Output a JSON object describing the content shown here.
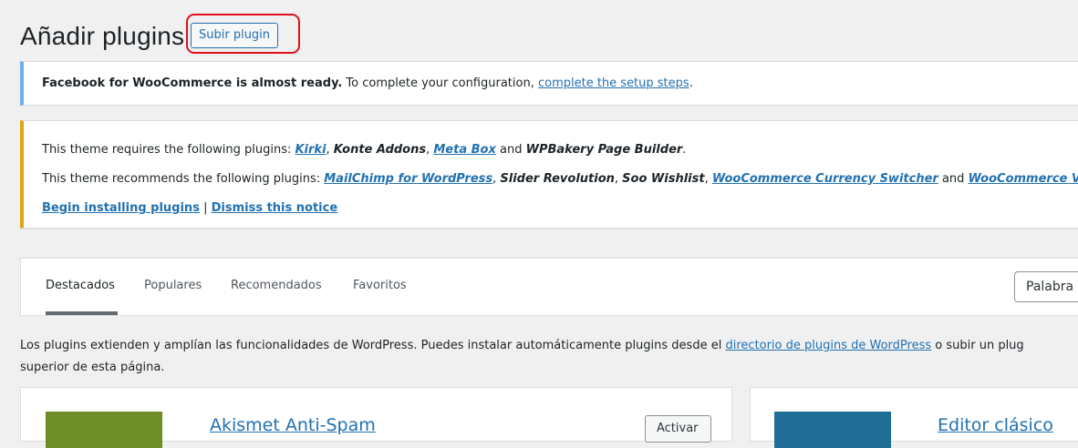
{
  "header": {
    "title": "Añadir plugins",
    "upload_label": "Subir plugin"
  },
  "notices": {
    "facebook": {
      "bold": "Facebook for WooCommerce is almost ready.",
      "text": " To complete your configuration, ",
      "link": "complete the setup steps",
      "end": "."
    },
    "theme": {
      "requires_prefix": "This theme requires the following plugins: ",
      "requires_p1": "Kirki",
      "requires_sep1": ", ",
      "requires_p2": "Konte Addons",
      "requires_sep2": ", ",
      "requires_p3": "Meta Box",
      "requires_and": " and ",
      "requires_p4": "WPBakery Page Builder",
      "requires_end": ".",
      "recommends_prefix": "This theme recommends the following plugins: ",
      "recommends_p1": "MailChimp for WordPress",
      "recommends_sep1": ", ",
      "recommends_p2": "Slider Revolution",
      "recommends_sep2": ", ",
      "recommends_p3": "Soo Wishlist",
      "recommends_sep3": ", ",
      "recommends_p4": "WooCommerce Currency Switcher",
      "recommends_and": " and ",
      "recommends_p5": "WooCommerce V",
      "begin_link": "Begin installing plugins",
      "separator": " | ",
      "dismiss_link": "Dismiss this notice"
    }
  },
  "tabs": [
    {
      "label": "Destacados",
      "current": true
    },
    {
      "label": "Populares"
    },
    {
      "label": "Recomendados"
    },
    {
      "label": "Favoritos"
    }
  ],
  "search": {
    "type_value": "Palabra"
  },
  "description": {
    "line1_text": "Los plugins extienden y amplían las funcionalidades de WordPress. Puedes instalar automáticamente plugins desde el ",
    "line1_link": "directorio de plugins de WordPress",
    "line1_end": " o subir un plug",
    "line2": "superior de esta página."
  },
  "cards": [
    {
      "name": "Akismet Anti-Spam",
      "button": "Activar"
    },
    {
      "name": "Editor clásico"
    }
  ],
  "colors": {
    "accent": "#2271b1",
    "highlight": "#e0101a",
    "info_border": "#72aee6",
    "warning_border": "#dba617",
    "akismet_thumb": "#6e8d27",
    "editor_thumb": "#206e96"
  }
}
